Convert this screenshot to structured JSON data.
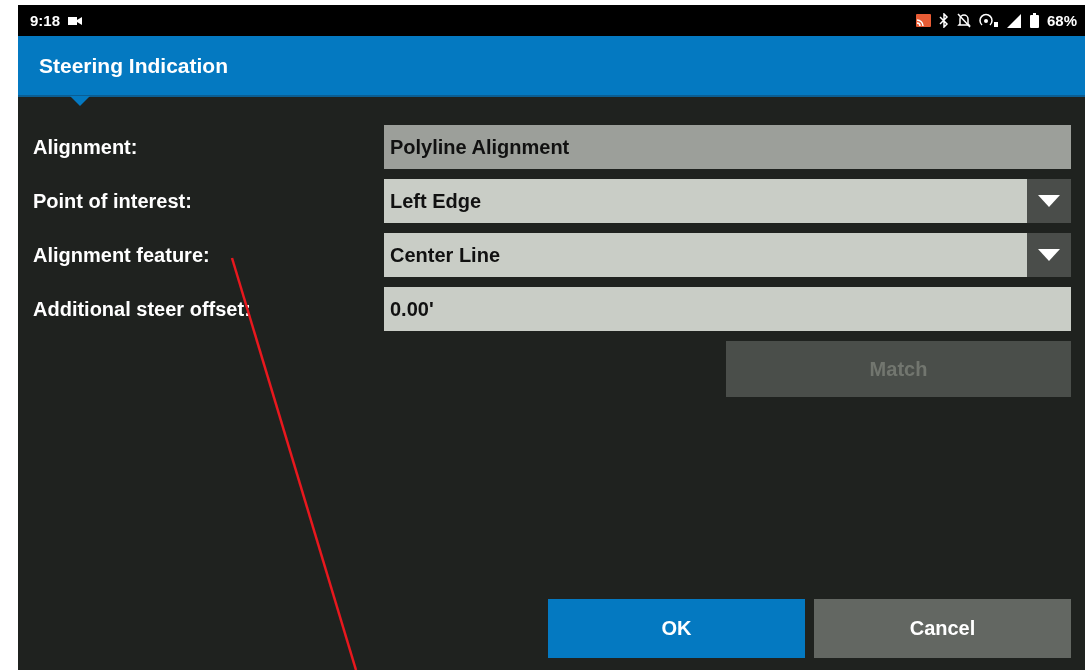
{
  "status_bar": {
    "time": "9:18",
    "battery_text": "68%"
  },
  "header": {
    "title": "Steering Indication"
  },
  "fields": [
    {
      "label": "Alignment:",
      "kind": "readonly",
      "value": "Polyline Alignment"
    },
    {
      "label": "Point of interest:",
      "kind": "dropdown",
      "value": "Left Edge"
    },
    {
      "label": "Alignment feature:",
      "kind": "dropdown",
      "value": "Center Line"
    },
    {
      "label": "Additional steer offset:",
      "kind": "input",
      "value": "0.00'"
    }
  ],
  "match_button": {
    "label": "Match",
    "disabled": true
  },
  "buttons": [
    {
      "label": "OK",
      "kind": "primary"
    },
    {
      "label": "Cancel",
      "kind": "secondary"
    }
  ]
}
